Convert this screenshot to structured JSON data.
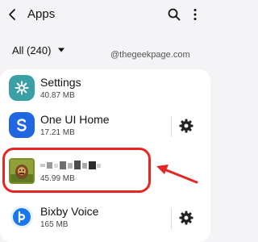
{
  "header": {
    "back_icon": "chevron-left-icon",
    "title": "Apps",
    "search_icon": "search-icon",
    "more_icon": "more-vertical-icon"
  },
  "filter": {
    "label": "All (240)",
    "caret_icon": "caret-down-icon"
  },
  "watermark": "@thegeekpage.com",
  "apps": [
    {
      "name": "Settings",
      "size": "40.87 MB",
      "icon": "settings-gear-icon",
      "icon_color": "#3aa0a5",
      "has_gear": false
    },
    {
      "name": "One UI Home",
      "size": "17.21 MB",
      "icon": "one-ui-home-icon",
      "icon_color": "#1f66e0",
      "has_gear": true
    },
    {
      "name": "",
      "size": "45.99 MB",
      "icon": "game-app-icon",
      "icon_color": "#7b8f2b",
      "has_gear": false,
      "highlighted": true
    },
    {
      "name": "Bixby Voice",
      "size": "165 MB",
      "icon": "bixby-icon",
      "icon_color": "#1976f2",
      "has_gear": true
    }
  ],
  "annotation": {
    "highlight_color": "#e32722",
    "arrow_icon": "red-arrow-icon"
  }
}
